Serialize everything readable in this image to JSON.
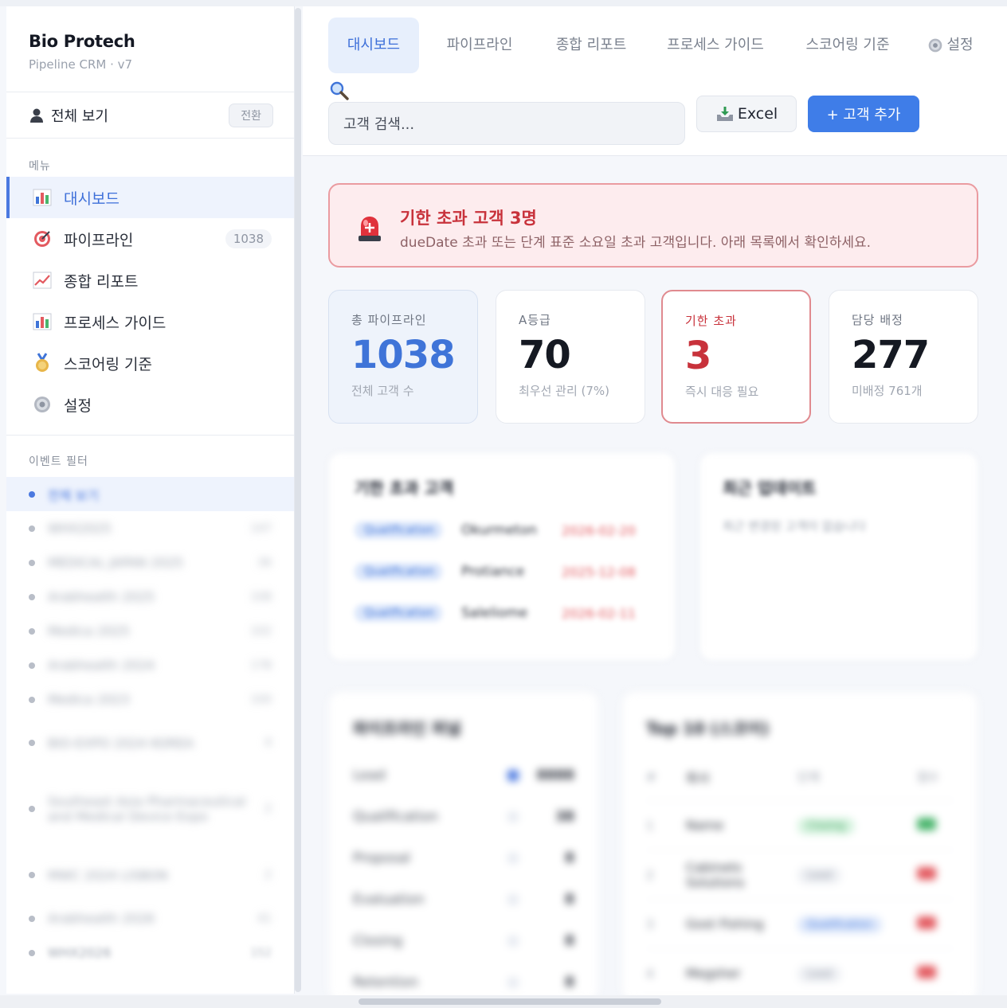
{
  "brand": {
    "title": "Bio Protech",
    "subtitle": "Pipeline CRM · v7"
  },
  "view_all": {
    "label": "전체 보기",
    "switch_label": "전환"
  },
  "menu": {
    "section_label": "메뉴",
    "items": [
      {
        "label": "대시보드",
        "icon": "bar-chart-icon",
        "active": true
      },
      {
        "label": "파이프라인",
        "icon": "target-icon",
        "count": "1038"
      },
      {
        "label": "종합 리포트",
        "icon": "line-chart-icon"
      },
      {
        "label": "프로세스 가이드",
        "icon": "bar-chart-icon"
      },
      {
        "label": "스코어링 기준",
        "icon": "medal-icon"
      },
      {
        "label": "설정",
        "icon": "gear-icon"
      }
    ]
  },
  "event_filter": {
    "section_label": "이벤트 필터",
    "items": [
      {
        "label": "전체 보기",
        "active": true
      },
      {
        "label": "WHX2025",
        "count": "147"
      },
      {
        "label": "MEDICAL JAPAN 2025",
        "count": "36"
      },
      {
        "label": "Arabhealth 2025",
        "count": "108"
      },
      {
        "label": "Medica 2025",
        "count": "102"
      },
      {
        "label": "Arabhealth 2024",
        "count": "178"
      },
      {
        "label": "Medica 2023",
        "count": "100"
      },
      {
        "label": "BIO-EXPO 2024 KOREA",
        "count": "4"
      },
      {
        "label": "Southeast Asia Pharmaceutical and Medical Device Expo",
        "count": "2"
      },
      {
        "label": "MWC 2024 LISBON",
        "count": "2"
      },
      {
        "label": "Arabhealth 2026",
        "count": "41"
      },
      {
        "label": "WHX2026",
        "count": "152"
      }
    ]
  },
  "tabs": [
    {
      "label": "대시보드",
      "active": true
    },
    {
      "label": "파이프라인"
    },
    {
      "label": "종합 리포트"
    },
    {
      "label": "프로세스 가이드"
    },
    {
      "label": "스코어링 기준"
    },
    {
      "label": "설정",
      "icon": "gear-icon"
    }
  ],
  "search": {
    "placeholder": "고객 검색..."
  },
  "buttons": {
    "excel": "Excel",
    "add_customer": "+ 고객 추가"
  },
  "alert": {
    "title": "기한 초과 고객 3명",
    "description": "dueDate 초과 또는 단계 표준 소요일 초과 고객입니다. 아래 목록에서 확인하세요.",
    "icon": "siren-icon"
  },
  "kpis": [
    {
      "label": "총 파이프라인",
      "value": "1038",
      "sub": "전체 고객 수"
    },
    {
      "label": "A등급",
      "value": "70",
      "sub": "최우선 관리 (7%)"
    },
    {
      "label": "기한 초과",
      "value": "3",
      "sub": "즉시 대응 필요"
    },
    {
      "label": "담당 배정",
      "value": "277",
      "sub": "미배정 761개"
    }
  ],
  "overdue_card": {
    "title": "기한 초과 고객",
    "rows": [
      {
        "tag": "Qualification",
        "name": "Okurmeton",
        "date": "2026-02-20"
      },
      {
        "tag": "Qualification",
        "name": "Protiance",
        "date": "2025-12-08"
      },
      {
        "tag": "Qualification",
        "name": "Saleliome",
        "date": "2026-02-11"
      }
    ]
  },
  "right_card": {
    "title": "최근 업데이트",
    "subtitle": "최근 변경된 고객이 없습니다"
  },
  "funnel_card": {
    "title": "파이프라인 퍼널",
    "rows": [
      {
        "stage": "Lead",
        "count": "8888",
        "on": true
      },
      {
        "stage": "Qualification",
        "count": "38"
      },
      {
        "stage": "Proposal",
        "count": "8"
      },
      {
        "stage": "Evaluation",
        "count": "8"
      },
      {
        "stage": "Closing",
        "count": "8"
      },
      {
        "stage": "Retention",
        "count": "8"
      }
    ]
  },
  "top_card": {
    "title": "Top 10 (스코어)",
    "headers": [
      "#",
      "회사",
      "단계",
      "점수"
    ],
    "rows": [
      {
        "num": "1",
        "name": "Name",
        "stage": "Closing",
        "stage_color": "green",
        "score_color": "green"
      },
      {
        "num": "2",
        "name": "Cabinets Solutions",
        "stage": "Lead",
        "stage_color": "gray",
        "score_color": "red"
      },
      {
        "num": "3",
        "name": "Gost Fishing",
        "stage": "Qualification",
        "stage_color": "blue",
        "score_color": "red"
      },
      {
        "num": "4",
        "name": "Megsher",
        "stage": "Lead",
        "stage_color": "gray",
        "score_color": "red"
      }
    ]
  }
}
